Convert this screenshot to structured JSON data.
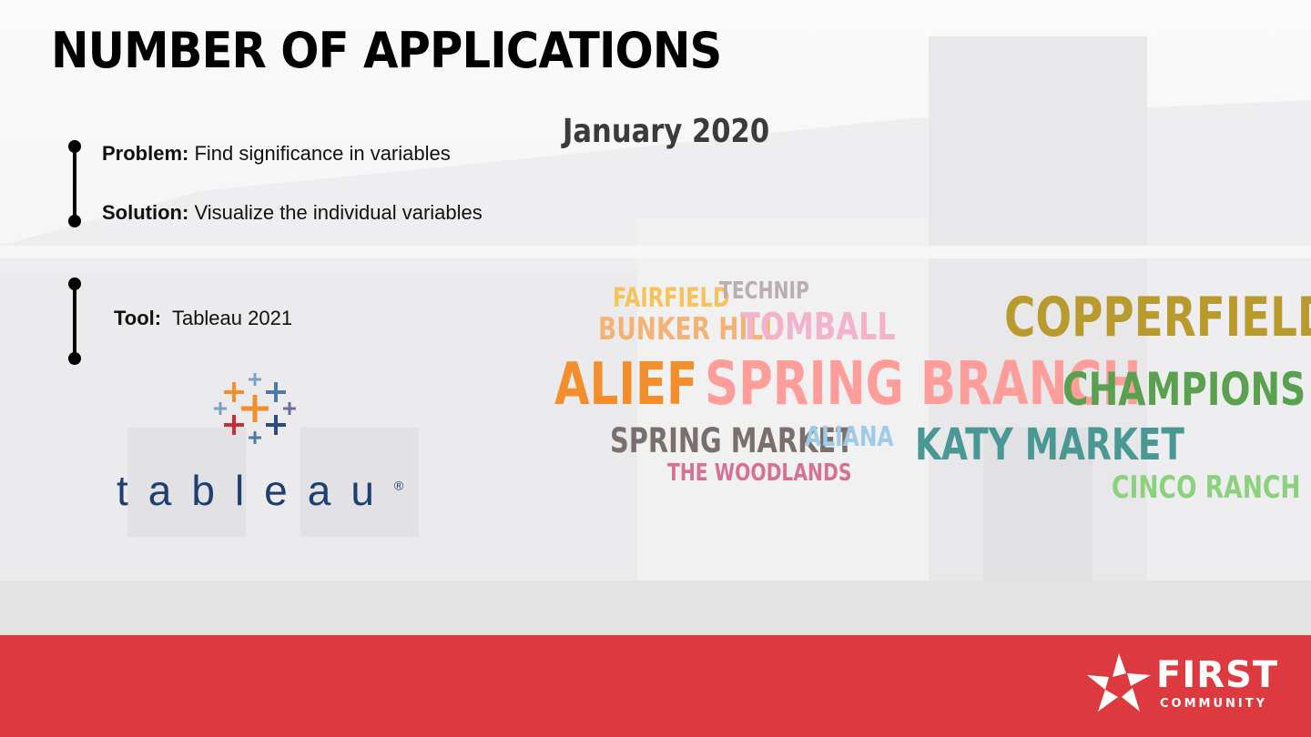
{
  "slide": {
    "title": "NUMBER OF APPLICATIONS",
    "period": "January 2020"
  },
  "notes": {
    "problem_label": "Problem:",
    "problem_text": "Find significance in variables",
    "solution_label": "Solution:",
    "solution_text": "Visualize the individual variables",
    "tool_label": "Tool:",
    "tool_text": "Tableau 2021"
  },
  "tableau_logo": {
    "wordmark": "tableau",
    "registered": "®",
    "icon": "tableau-cross-icon"
  },
  "word_cloud": [
    {
      "text": "FAIRFIELD",
      "color": "#f5c35a"
    },
    {
      "text": "TECHNIP",
      "color": "#b9aeb0"
    },
    {
      "text": "BUNKER HILL",
      "color": "#f4b376"
    },
    {
      "text": "TOMBALL",
      "color": "#f4b3cc"
    },
    {
      "text": "COPPERFIELD",
      "color": "#b99a2c"
    },
    {
      "text": "ALIEF",
      "color": "#f28e2b"
    },
    {
      "text": "SPRING BRANCH",
      "color": "#ff9d9a"
    },
    {
      "text": "CHAMPIONS",
      "color": "#59a14f"
    },
    {
      "text": "SPRING MARKET",
      "color": "#79706e"
    },
    {
      "text": "ALIANA",
      "color": "#a0cbe8"
    },
    {
      "text": "KATY MARKET",
      "color": "#499894"
    },
    {
      "text": "THE WOODLANDS",
      "color": "#d37295"
    },
    {
      "text": "CINCO RANCH",
      "color": "#8cd17d"
    }
  ],
  "brand": {
    "footer_color": "#dd3a40",
    "logo_first": "FIRST",
    "logo_community": "COMMUNITY",
    "logo_icon": "star-logo-icon"
  }
}
